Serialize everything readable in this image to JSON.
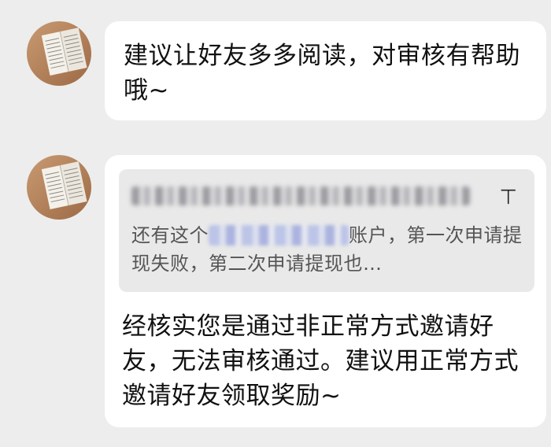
{
  "messages": [
    {
      "avatar_icon": "book-photo-avatar",
      "text": "建议让好友多多阅读，对审核有帮助哦~"
    },
    {
      "avatar_icon": "book-photo-avatar",
      "quote": {
        "sender_name": "",
        "pin_icon": "pin-top-icon",
        "pin_glyph": "⊤",
        "text_before": "还有这个",
        "text_after": "账户，第一次申请提现失败，第二次申请提现也…"
      },
      "text": "经核实您是通过非正常方式邀请好友，无法审核通过。建议用正常方式邀请好友领取奖励~"
    }
  ],
  "colors": {
    "background": "#ededed",
    "bubble": "#ffffff",
    "quote_bg": "#e9e9e9",
    "text": "#111111",
    "quote_text": "#555555"
  }
}
